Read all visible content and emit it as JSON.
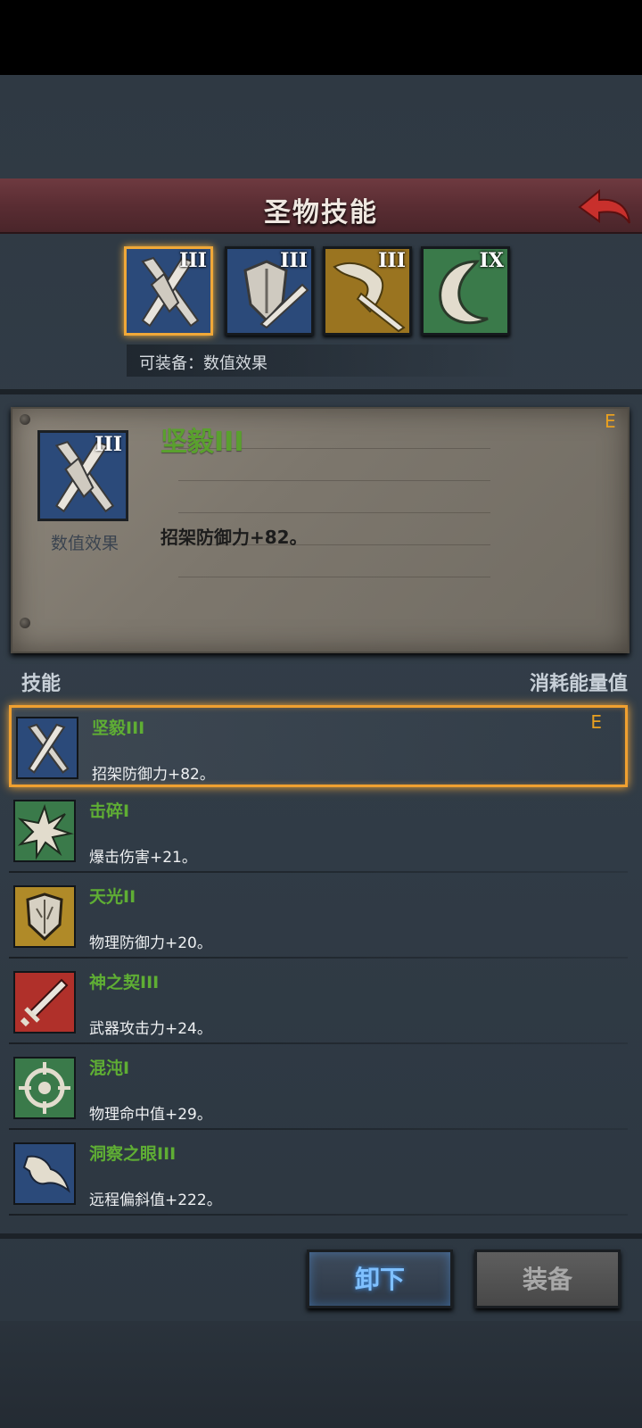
{
  "header": {
    "title": "圣物技能",
    "back_icon": "back-arrow-icon"
  },
  "relics": [
    {
      "level": "III",
      "icon": "crossed-swords-icon",
      "color": "#2b4a7a",
      "selected": true
    },
    {
      "level": "III",
      "icon": "shield-sword-icon",
      "color": "#2b4a7a",
      "selected": false
    },
    {
      "level": "III",
      "icon": "winged-sword-icon",
      "color": "#9a7420",
      "selected": false
    },
    {
      "level": "IX",
      "icon": "crescent-moon-icon",
      "color": "#3a7a4a",
      "selected": false
    }
  ],
  "equip_hint": "可装备：数值效果",
  "detail": {
    "level": "III",
    "type_label": "数值效果",
    "name": "坚毅III",
    "description": "招架防御力+82。",
    "equipped_mark": "E"
  },
  "list_header": {
    "left": "技能",
    "right": "消耗能量值"
  },
  "skills": [
    {
      "name": "坚毅III",
      "desc": "招架防御力+82。",
      "icon": "crossed-swords-icon",
      "bg": "#2b4a7a",
      "equipped": "E",
      "selected": true
    },
    {
      "name": "击碎I",
      "desc": "爆击伤害+21。",
      "icon": "burst-icon",
      "bg": "#3a7a4a",
      "equipped": "",
      "selected": false
    },
    {
      "name": "天光II",
      "desc": "物理防御力+20。",
      "icon": "shield-icon",
      "bg": "#b08a28",
      "equipped": "",
      "selected": false
    },
    {
      "name": "神之契III",
      "desc": "武器攻击力+24。",
      "icon": "sword-icon",
      "bg": "#b0302a",
      "equipped": "",
      "selected": false
    },
    {
      "name": "混沌I",
      "desc": "物理命中值+29。",
      "icon": "crosshair-icon",
      "bg": "#3a7a4a",
      "equipped": "",
      "selected": false
    },
    {
      "name": "洞察之眼III",
      "desc": "远程偏斜值+222。",
      "icon": "bird-icon",
      "bg": "#2b4a7a",
      "equipped": "",
      "selected": false
    }
  ],
  "buttons": {
    "unequip": "卸下",
    "equip": "装备"
  }
}
